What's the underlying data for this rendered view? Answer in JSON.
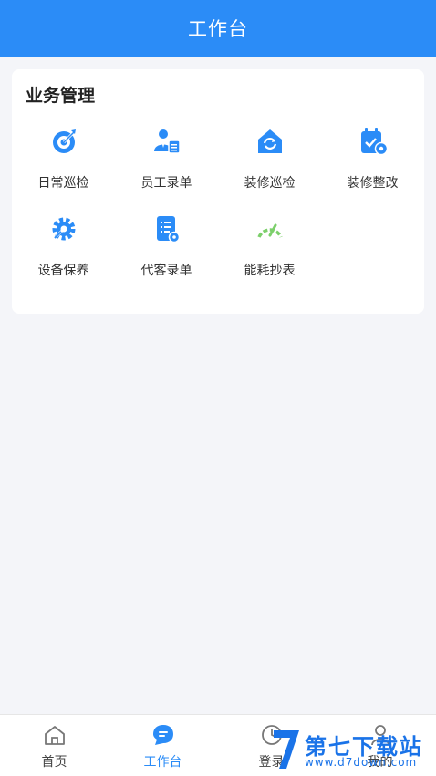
{
  "header": {
    "title": "工作台"
  },
  "section": {
    "title": "业务管理",
    "items": [
      {
        "label": "日常巡检",
        "icon": "target-icon"
      },
      {
        "label": "员工录单",
        "icon": "staff-list-icon"
      },
      {
        "label": "装修巡检",
        "icon": "house-refresh-icon"
      },
      {
        "label": "装修整改",
        "icon": "calendar-gear-icon"
      },
      {
        "label": "设备保养",
        "icon": "gear-wrench-icon"
      },
      {
        "label": "代客录单",
        "icon": "document-icon"
      },
      {
        "label": "能耗抄表",
        "icon": "gauge-icon"
      }
    ]
  },
  "tabbar": {
    "tabs": [
      {
        "label": "首页",
        "icon": "home-icon"
      },
      {
        "label": "工作台",
        "icon": "chat-icon"
      },
      {
        "label": "登录",
        "icon": "clock-icon"
      },
      {
        "label": "我的",
        "icon": "user-icon"
      }
    ]
  },
  "watermark": {
    "title": "第七下载站",
    "url": "www.d7down.com"
  },
  "colors": {
    "primary": "#2b8cf7",
    "gauge": "#7ccf6b"
  }
}
